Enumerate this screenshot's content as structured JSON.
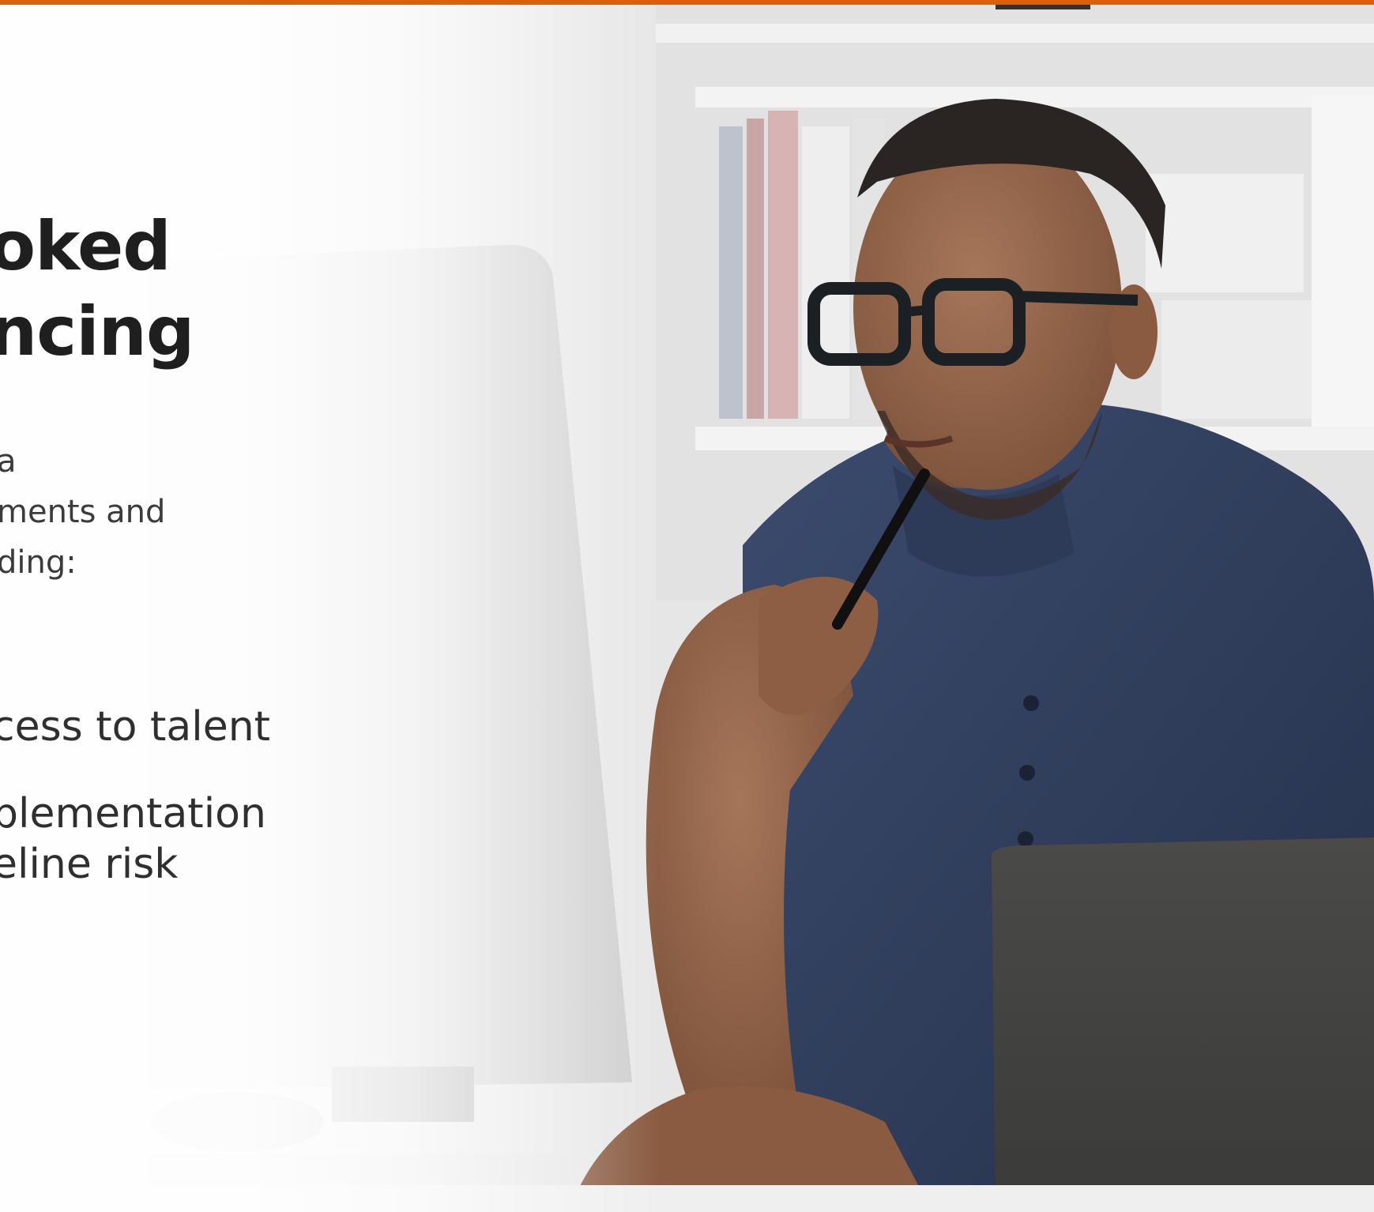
{
  "accent_color": "#d9600f",
  "hero": {
    "headline_lines": [
      "oked",
      "ncing"
    ],
    "intro_lines": [
      "a",
      "ments and",
      "ding:"
    ],
    "benefits": [
      {
        "lines": [
          "cess to talent"
        ]
      },
      {
        "lines": [
          "plementation",
          "eline risk"
        ]
      }
    ],
    "photo_icon": "man-at-computer-photo"
  }
}
